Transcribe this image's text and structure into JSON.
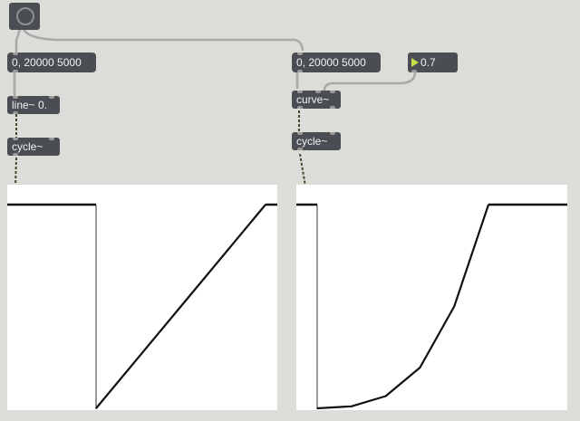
{
  "patch": {
    "bang": {
      "icon": "bang-circle-icon"
    },
    "messages": {
      "left_range": "0, 20000 5000",
      "right_range": "0, 20000 5000"
    },
    "number_box": {
      "value": "0.7",
      "arrow_icon": "number-triangle-icon"
    },
    "objects": {
      "line": "line~ 0.",
      "curve": "curve~",
      "cycle_left": "cycle~",
      "cycle_right": "cycle~"
    },
    "colors": {
      "canvas": "#dcdcd8",
      "object_box": "#4a4d51",
      "object_text": "#f2f2f2",
      "patch_cord": "#a8a8a8",
      "signal_cord": "#3c4a2c",
      "number_arrow": "#c8e04a",
      "scope_bg": "#ffffff",
      "trace": "#111111"
    }
  },
  "chart_data": [
    {
      "type": "line",
      "title": "",
      "xlabel": "",
      "ylabel": "",
      "x": [
        0,
        0.5,
        1
      ],
      "y": [
        0,
        0.5,
        1
      ],
      "xlim": [
        0,
        1
      ],
      "ylim": [
        0,
        1
      ],
      "grid": false
    },
    {
      "type": "line",
      "title": "",
      "xlabel": "",
      "ylabel": "",
      "x": [
        0,
        0.2,
        0.4,
        0.6,
        0.8,
        1
      ],
      "y": [
        0,
        0.01,
        0.06,
        0.2,
        0.5,
        1
      ],
      "xlim": [
        0,
        1
      ],
      "ylim": [
        0,
        1
      ],
      "grid": false
    }
  ]
}
